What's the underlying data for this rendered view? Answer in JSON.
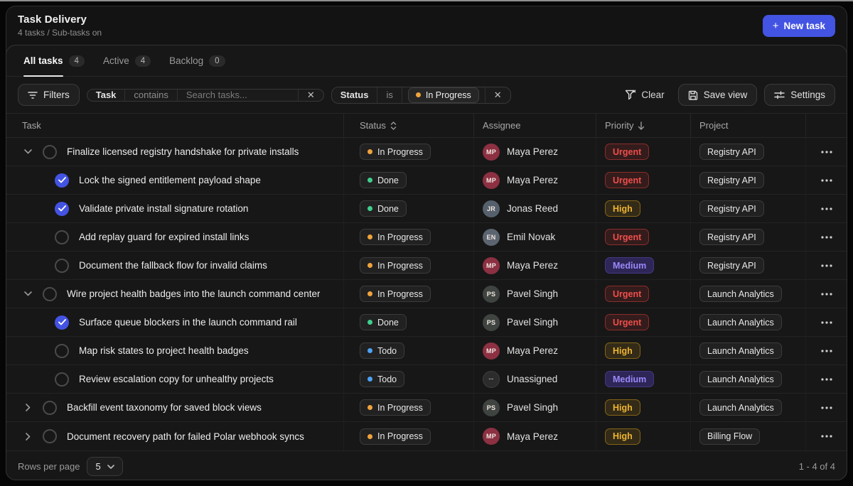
{
  "header": {
    "title": "Task Delivery",
    "subtitle": "4 tasks / Sub-tasks on",
    "new_task_plus": "+",
    "new_task_label": "New task"
  },
  "tabs": [
    {
      "label": "All tasks",
      "count": "4",
      "active": true
    },
    {
      "label": "Active",
      "count": "4",
      "active": false
    },
    {
      "label": "Backlog",
      "count": "0",
      "active": false
    }
  ],
  "filter_bar": {
    "filters_label": "Filters",
    "task_filter": {
      "field": "Task",
      "operator": "contains",
      "placeholder": "Search tasks...",
      "close": "✕"
    },
    "status_filter": {
      "field": "Status",
      "operator": "is",
      "value": "In Progress",
      "close": "✕"
    },
    "clear_label": "Clear",
    "save_view_label": "Save view",
    "settings_label": "Settings"
  },
  "table": {
    "columns": [
      {
        "label": "Task",
        "key": "task"
      },
      {
        "label": "Status",
        "key": "status",
        "sort": "both"
      },
      {
        "label": "Assignee",
        "key": "assignee"
      },
      {
        "label": "Priority",
        "key": "priority",
        "sort": "down"
      },
      {
        "label": "Project",
        "key": "project"
      },
      {
        "label": "",
        "key": "actions"
      }
    ],
    "rows": [
      {
        "type": "parent",
        "expanded": true,
        "checked": false,
        "title": "Finalize licensed registry handshake for private installs",
        "status": "In Progress",
        "assignee": "Maya Perez",
        "priority": "Urgent",
        "project": "Registry API"
      },
      {
        "type": "sub",
        "checked": true,
        "title": "Lock the signed entitlement payload shape",
        "status": "Done",
        "assignee": "Maya Perez",
        "priority": "Urgent",
        "project": "Registry API"
      },
      {
        "type": "sub",
        "checked": true,
        "title": "Validate private install signature rotation",
        "status": "Done",
        "assignee": "Jonas Reed",
        "priority": "High",
        "project": "Registry API"
      },
      {
        "type": "sub",
        "checked": false,
        "title": "Add replay guard for expired install links",
        "status": "In Progress",
        "assignee": "Emil Novak",
        "priority": "Urgent",
        "project": "Registry API"
      },
      {
        "type": "sub",
        "checked": false,
        "title": "Document the fallback flow for invalid claims",
        "status": "In Progress",
        "assignee": "Maya Perez",
        "priority": "Medium",
        "project": "Registry API"
      },
      {
        "type": "parent",
        "expanded": true,
        "checked": false,
        "title": "Wire project health badges into the launch command center",
        "status": "In Progress",
        "assignee": "Pavel Singh",
        "priority": "Urgent",
        "project": "Launch Analytics"
      },
      {
        "type": "sub",
        "checked": true,
        "title": "Surface queue blockers in the launch command rail",
        "status": "Done",
        "assignee": "Pavel Singh",
        "priority": "Urgent",
        "project": "Launch Analytics"
      },
      {
        "type": "sub",
        "checked": false,
        "title": "Map risk states to project health badges",
        "status": "Todo",
        "assignee": "Maya Perez",
        "priority": "High",
        "project": "Launch Analytics"
      },
      {
        "type": "sub",
        "checked": false,
        "title": "Review escalation copy for unhealthy projects",
        "status": "Todo",
        "assignee": "Unassigned",
        "priority": "Medium",
        "project": "Launch Analytics"
      },
      {
        "type": "parent",
        "expanded": false,
        "checked": false,
        "title": "Backfill event taxonomy for saved block views",
        "status": "In Progress",
        "assignee": "Pavel Singh",
        "priority": "High",
        "project": "Launch Analytics"
      },
      {
        "type": "parent",
        "expanded": false,
        "checked": false,
        "title": "Document recovery path for failed Polar webhook syncs",
        "status": "In Progress",
        "assignee": "Maya Perez",
        "priority": "High",
        "project": "Billing Flow"
      }
    ]
  },
  "footer": {
    "rows_per_page_label": "Rows per page",
    "rows_per_page_value": "5",
    "range_label": "1 - 4 of 4"
  },
  "assignees": {
    "Maya Perez": {
      "initials": "MP",
      "color": "#8c3042"
    },
    "Jonas Reed": {
      "initials": "JR",
      "color": "#56606c"
    },
    "Emil Novak": {
      "initials": "EN",
      "color": "#5c6470"
    },
    "Pavel Singh": {
      "initials": "PS",
      "color": "#3f4440"
    },
    "Unassigned": {
      "initials": "--",
      "color": "#2c2c2c",
      "muted": true
    }
  },
  "colors": {
    "accent": "#4353e2",
    "status_dots": {
      "In Progress": "#f0a33c",
      "Done": "#3fcf8e",
      "Todo": "#4da2f5"
    },
    "urgent_fg": "#ef4f4b",
    "high_fg": "#eeb332",
    "medium_fg": "#9a89f8"
  }
}
